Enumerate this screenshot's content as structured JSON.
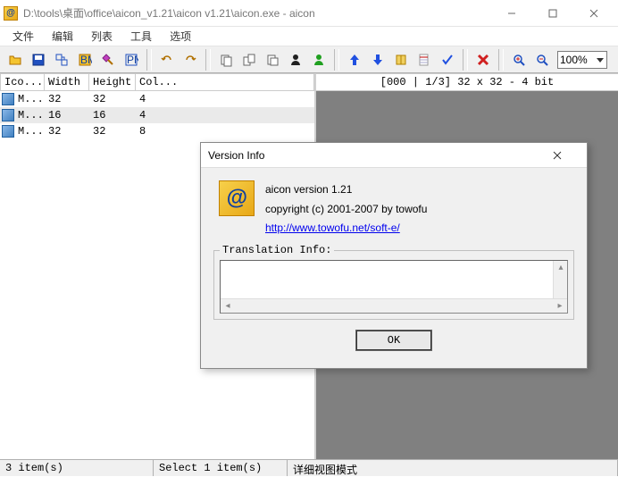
{
  "window": {
    "title": "D:\\tools\\桌面\\office\\aicon_v1.21\\aicon v1.21\\aicon.exe - aicon"
  },
  "menus": [
    "文件",
    "编辑",
    "列表",
    "工具",
    "选项"
  ],
  "toolbar": {
    "zoom": "100%"
  },
  "list": {
    "headers": {
      "icon": "Ico...",
      "width": "Width",
      "height": "Height",
      "colors": "Col..."
    },
    "rows": [
      {
        "name": "M...",
        "width": "32",
        "height": "32",
        "colors": "4",
        "selected": false
      },
      {
        "name": "M...",
        "width": "16",
        "height": "16",
        "colors": "4",
        "selected": true
      },
      {
        "name": "M...",
        "width": "32",
        "height": "32",
        "colors": "8",
        "selected": false
      }
    ]
  },
  "preview": {
    "header": "[000 | 1/3] 32 x 32 - 4 bit"
  },
  "status": {
    "items": "3 item(s)",
    "selected": "Select 1 item(s)",
    "mode": "详细视图模式"
  },
  "dialog": {
    "title": "Version Info",
    "version_line": "aicon version 1.21",
    "copyright": "copyright (c) 2001-2007 by towofu",
    "url": "http://www.towofu.net/soft-e/",
    "translation_label": "Translation Info:",
    "ok": "OK"
  }
}
